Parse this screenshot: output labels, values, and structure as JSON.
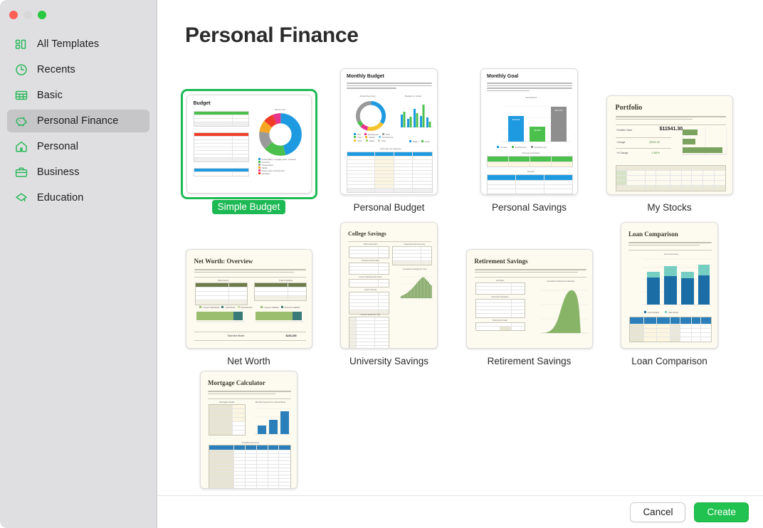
{
  "window": {
    "traffic_lights": [
      "close",
      "minimize",
      "zoom"
    ]
  },
  "sidebar": {
    "items": [
      {
        "id": "all-templates",
        "label": "All Templates",
        "icon": "grid-blocks-icon",
        "active": false
      },
      {
        "id": "recents",
        "label": "Recents",
        "icon": "clock-icon",
        "active": false
      },
      {
        "id": "basic",
        "label": "Basic",
        "icon": "table-icon",
        "active": false
      },
      {
        "id": "personal-finance",
        "label": "Personal Finance",
        "icon": "piggy-bank-icon",
        "active": true
      },
      {
        "id": "personal",
        "label": "Personal",
        "icon": "house-icon",
        "active": false
      },
      {
        "id": "business",
        "label": "Business",
        "icon": "briefcase-icon",
        "active": false
      },
      {
        "id": "education",
        "label": "Education",
        "icon": "graduation-cap-icon",
        "active": false
      }
    ]
  },
  "main": {
    "title": "Personal Finance",
    "templates": [
      {
        "id": "simple-budget",
        "label": "Simple Budget",
        "selected": true,
        "doc_title": "Budget",
        "paper": "white"
      },
      {
        "id": "personal-budget",
        "label": "Personal Budget",
        "selected": false,
        "doc_title": "Monthly Budget",
        "paper": "white"
      },
      {
        "id": "personal-savings",
        "label": "Personal Savings",
        "selected": false,
        "doc_title": "Monthly Goal",
        "paper": "white"
      },
      {
        "id": "my-stocks",
        "label": "My Stocks",
        "selected": false,
        "doc_title": "Portfolio",
        "paper": "cream"
      },
      {
        "id": "net-worth",
        "label": "Net Worth",
        "selected": false,
        "doc_title": "Net Worth: Overview",
        "paper": "cream"
      },
      {
        "id": "university-savings",
        "label": "University Savings",
        "selected": false,
        "doc_title": "College Savings",
        "paper": "cream"
      },
      {
        "id": "retirement-savings",
        "label": "Retirement Savings",
        "selected": false,
        "doc_title": "Retirement Savings",
        "paper": "cream"
      },
      {
        "id": "loan-comparison",
        "label": "Loan Comparison",
        "selected": false,
        "doc_title": "Loan Comparison",
        "paper": "cream"
      },
      {
        "id": "mortgage-calculator",
        "label": "",
        "selected": false,
        "doc_title": "Mortgage Calculator",
        "paper": "cream"
      }
    ],
    "thumb_details": {
      "simple_budget": {
        "tables": [
          "Money In",
          "Money Out",
          "Money Left Over"
        ],
        "chart_title": "Money Out",
        "chart_type": "donut"
      },
      "personal_budget": {
        "charts": [
          "Actual Summary",
          "Budget vs. Actual"
        ],
        "table_title": "Summary by Category",
        "legend": [
          "Budget",
          "Actual"
        ]
      },
      "personal_savings": {
        "chart_title": "Total Saved",
        "tables": [
          "Savings Calculator",
          "Results"
        ],
        "legend": [
          "You save",
          "Contribute less",
          "Contribute more"
        ]
      },
      "my_stocks": {
        "metrics": [
          {
            "label": "Portfolio Value",
            "value": "$11541.30"
          },
          {
            "label": "Change",
            "value": "$293.30"
          },
          {
            "label": "% Change",
            "value": "2.60%"
          }
        ]
      },
      "net_worth": {
        "panels": [
          "Total Assets",
          "Total Liabilities"
        ],
        "footer_label": "Total Net Worth:",
        "footer_value": "$226,205"
      },
      "university_savings": {
        "chart_title": "Cumulative Savings Per Year"
      },
      "retirement_savings": {
        "chart_title": "Cumulative Retirement Savings",
        "tables": [
          "Life Plans",
          "Financial Information",
          "Retirement Goals"
        ]
      },
      "loan_comparison": {
        "chart_title": "Loan Summary",
        "legend": [
          "Loan Principal",
          "Total Interest"
        ],
        "bars": [
          "Loan #1",
          "Loan #2",
          "Loan #3",
          "Loan #4"
        ]
      },
      "mortgage_calculator": {
        "chart_title": "Monthly Payment by Interest Rate",
        "tables": [
          "Mortgage Details",
          "Possible Payments"
        ]
      }
    }
  },
  "footer": {
    "cancel_label": "Cancel",
    "create_label": "Create"
  },
  "colors": {
    "accent_green": "#21c24f",
    "selection_green": "#1db954",
    "sidebar_bg": "#dfdfe1",
    "sidebar_active": "#c6c6c9",
    "cream_paper": "#fdfaf0"
  }
}
